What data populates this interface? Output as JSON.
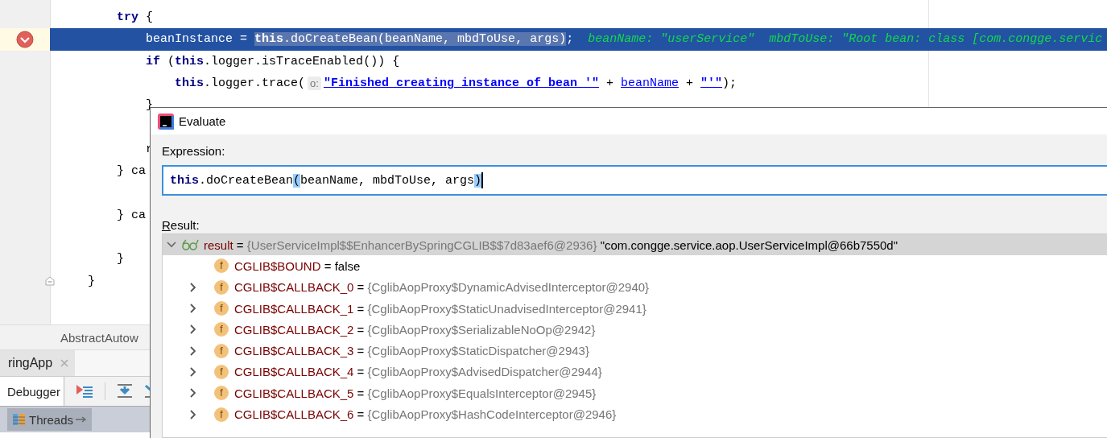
{
  "editor": {
    "lines": [
      {
        "tokens": [
          {
            "t": "        try",
            "kind": "keyword"
          },
          {
            "t": " {",
            "kind": "plain"
          }
        ]
      },
      {
        "current": true,
        "breakpoint": true,
        "tokens": [
          {
            "t": "            beanInstance = ",
            "kind": "plain"
          },
          {
            "t": "this",
            "kind": "keyword",
            "selected": true
          },
          {
            "t": ".doCreateBean(beanName, mbdToUse, args)",
            "kind": "plain",
            "selected": true
          },
          {
            "t": ";",
            "kind": "plain"
          },
          {
            "t": "beanName: \"userService\"  mbdToUse: \"Root bean: class [com.congge.servic",
            "kind": "hint"
          }
        ]
      },
      {
        "tokens": [
          {
            "t": "            if",
            "kind": "keyword"
          },
          {
            "t": " (",
            "kind": "plain"
          },
          {
            "t": "this",
            "kind": "keyword"
          },
          {
            "t": ".logger.isTraceEnabled()) {",
            "kind": "plain"
          }
        ]
      },
      {
        "tokens": [
          {
            "t": "                this",
            "kind": "keyword"
          },
          {
            "t": ".logger.trace(",
            "kind": "plain"
          },
          {
            "t": "o:",
            "kind": "param"
          },
          {
            "t": "\"Finished creating instance of bean '\"",
            "kind": "string"
          },
          {
            "t": " + ",
            "kind": "plain"
          },
          {
            "t": "beanName",
            "kind": "link"
          },
          {
            "t": " + ",
            "kind": "plain"
          },
          {
            "t": "\"'\"",
            "kind": "string"
          },
          {
            "t": ");",
            "kind": "plain"
          }
        ]
      },
      {
        "tokens": [
          {
            "t": "            }",
            "kind": "plain"
          }
        ]
      },
      {
        "gap_above": true,
        "tokens": [
          {
            "t": "            r",
            "kind": "plain"
          }
        ]
      },
      {
        "tokens": [
          {
            "t": "        } ca",
            "kind": "plain"
          }
        ]
      },
      {
        "gap_above": true,
        "tokens": [
          {
            "t": "        } ca",
            "kind": "plain"
          }
        ]
      },
      {
        "gap_above": true,
        "tokens": [
          {
            "t": "        }",
            "kind": "plain"
          }
        ]
      },
      {
        "fold": true,
        "tokens": [
          {
            "t": "    }",
            "kind": "plain"
          }
        ]
      }
    ]
  },
  "breadcrumb": "AbstractAutow",
  "debug_panel": {
    "session_tab": "ringApp",
    "tabs": [
      {
        "label": "Debugger",
        "selected": true
      }
    ],
    "layout_tab": "Threads"
  },
  "dialog": {
    "title": "Evaluate",
    "expression_label": "Expression:",
    "expression": {
      "keyword": "this",
      "rest": ".doCreateBean",
      "args": "(beanName, mbdToUse, args)"
    },
    "result_label": "Result:",
    "result": {
      "name": "result",
      "op": "=",
      "value": "{UserServiceImpl$$EnhancerBySpringCGLIB$$7d83aef6@2936}",
      "string": "\"com.congge.service.aop.UserServiceImpl@66b7550d\"",
      "expanded": true,
      "selected": true,
      "children": [
        {
          "icon": "f",
          "name": "CGLIB$BOUND",
          "op": "=",
          "value": "false",
          "kind": "primitive",
          "expandable": false
        },
        {
          "icon": "f",
          "name": "CGLIB$CALLBACK_0",
          "op": "=",
          "value": "{CglibAopProxy$DynamicAdvisedInterceptor@2940}",
          "kind": "object",
          "expandable": true
        },
        {
          "icon": "f",
          "name": "CGLIB$CALLBACK_1",
          "op": "=",
          "value": "{CglibAopProxy$StaticUnadvisedInterceptor@2941}",
          "kind": "object",
          "expandable": true
        },
        {
          "icon": "f",
          "name": "CGLIB$CALLBACK_2",
          "op": "=",
          "value": "{CglibAopProxy$SerializableNoOp@2942}",
          "kind": "object",
          "expandable": true
        },
        {
          "icon": "f",
          "name": "CGLIB$CALLBACK_3",
          "op": "=",
          "value": "{CglibAopProxy$StaticDispatcher@2943}",
          "kind": "object",
          "expandable": true
        },
        {
          "icon": "f",
          "name": "CGLIB$CALLBACK_4",
          "op": "=",
          "value": "{CglibAopProxy$AdvisedDispatcher@2944}",
          "kind": "object",
          "expandable": true
        },
        {
          "icon": "f",
          "name": "CGLIB$CALLBACK_5",
          "op": "=",
          "value": "{CglibAopProxy$EqualsInterceptor@2945}",
          "kind": "object",
          "expandable": true
        },
        {
          "icon": "f",
          "name": "CGLIB$CALLBACK_6",
          "op": "=",
          "value": "{CglibAopProxy$HashCodeInterceptor@2946}",
          "kind": "object",
          "expandable": true
        }
      ]
    }
  }
}
